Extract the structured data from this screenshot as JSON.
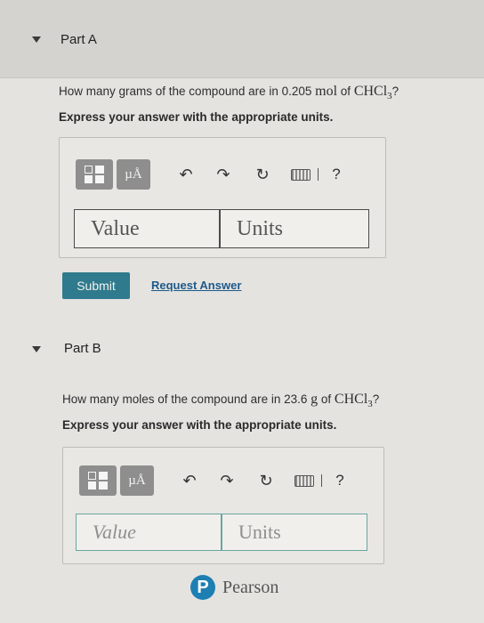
{
  "partA": {
    "title": "Part A",
    "question_prefix": "How many grams of the compound are in 0.205 ",
    "question_unit": "mol",
    "question_mid": " of ",
    "formula_main": "CHCl",
    "formula_sub": "3",
    "question_suffix": "?",
    "instruction": "Express your answer with the appropriate units.",
    "toolbar": {
      "units_label": "µÅ",
      "undo": "↶",
      "redo": "↷",
      "reset": "↻",
      "help": "?"
    },
    "value_placeholder": "Value",
    "units_placeholder": "Units",
    "submit_label": "Submit",
    "request_label": "Request Answer"
  },
  "partB": {
    "title": "Part B",
    "question_prefix": "How many moles of the compound are in 23.6 ",
    "question_unit": "g",
    "question_mid": " of ",
    "formula_main": "CHCl",
    "formula_sub": "3",
    "question_suffix": "?",
    "instruction": "Express your answer with the appropriate units.",
    "toolbar": {
      "units_label": "µÅ",
      "undo": "↶",
      "redo": "↷",
      "reset": "↻",
      "help": "?"
    },
    "value_placeholder": "Value",
    "units_placeholder": "Units"
  },
  "footer": {
    "brand_letter": "P",
    "brand": "Pearson"
  },
  "colors": {
    "submit_bg": "#2f7a8c",
    "link": "#1e5a8a",
    "pearson_blue": "#1d7fb2"
  }
}
